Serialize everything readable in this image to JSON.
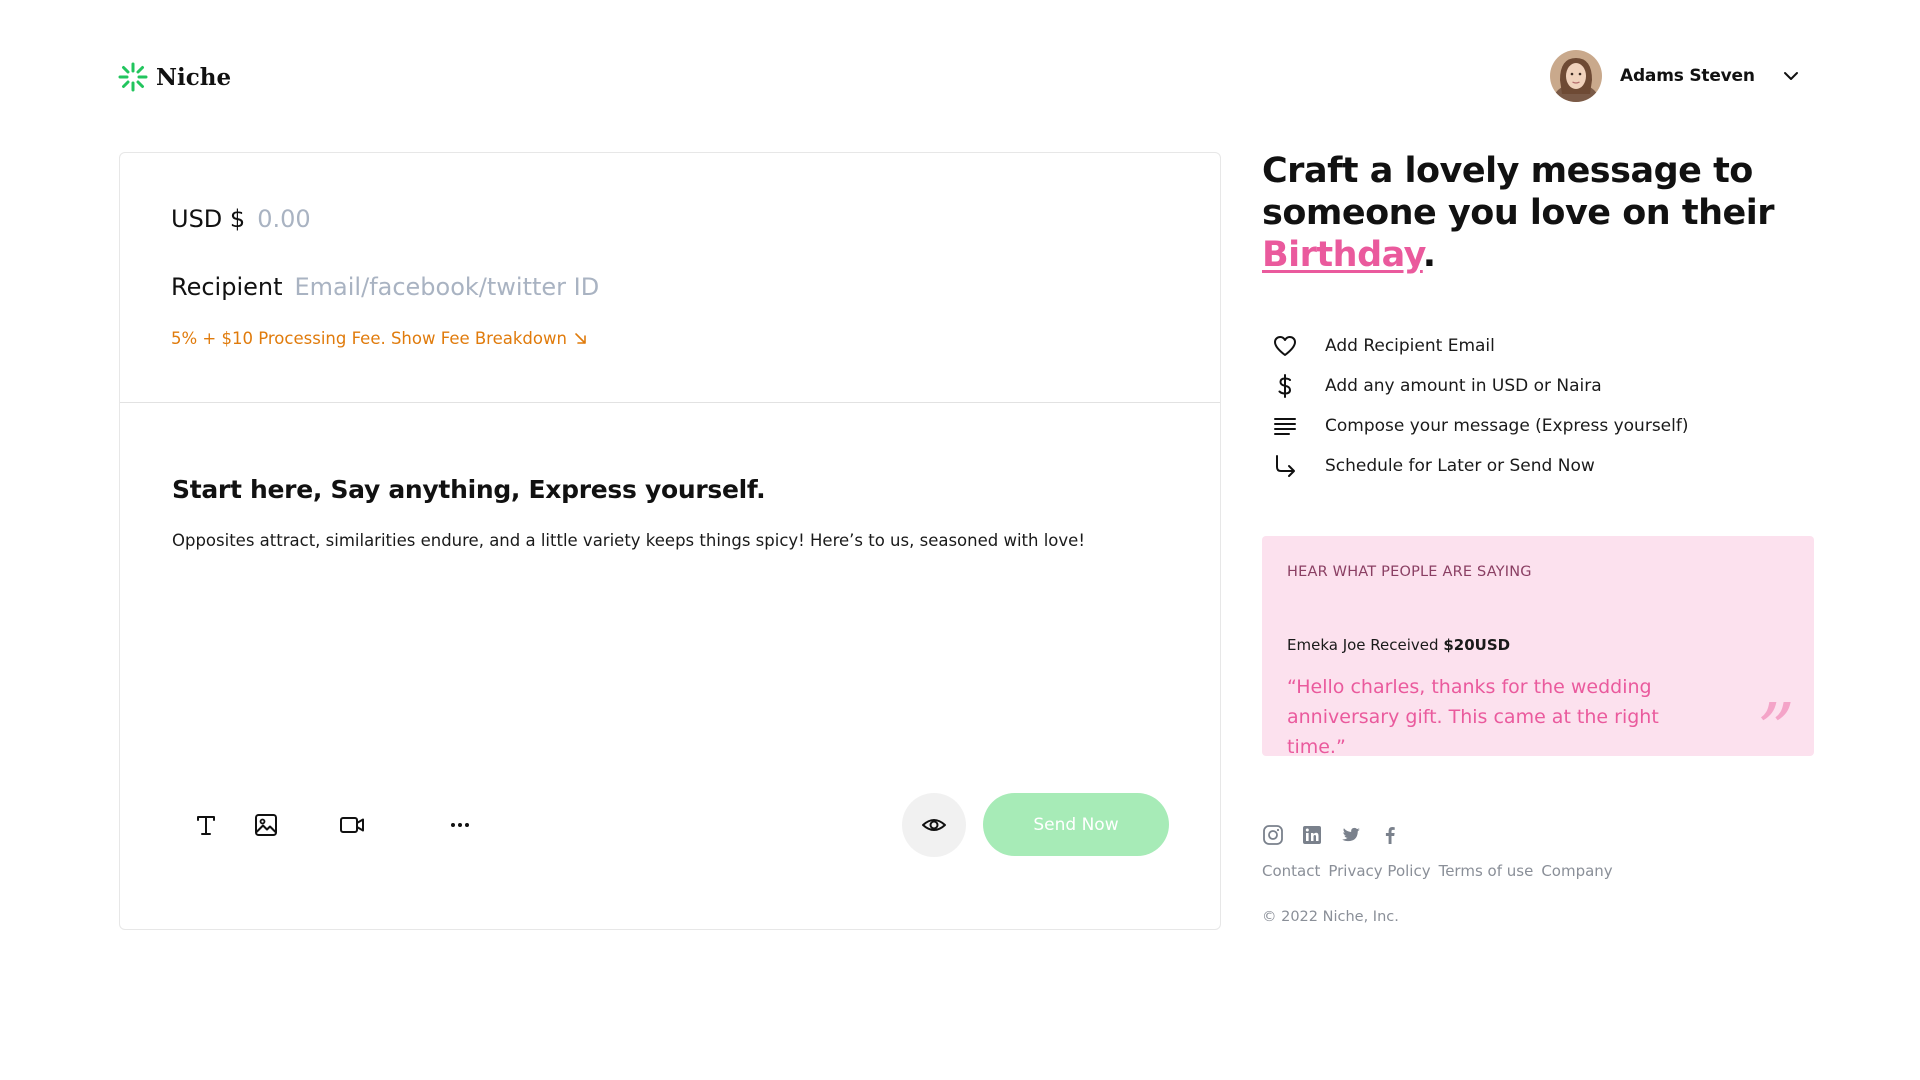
{
  "brand": {
    "name": "Niche",
    "accent": "#22c55e"
  },
  "user": {
    "name": "Adams Steven"
  },
  "form": {
    "currency_label": "USD $",
    "amount_placeholder": "0.00",
    "recipient_label": "Recipient",
    "recipient_placeholder": "Email/facebook/twitter ID",
    "fee_text": "5% + $10 Processing Fee. Show Fee Breakdown"
  },
  "message": {
    "title": "Start here, Say anything, Express yourself.",
    "body": "Opposites attract, similarities endure, and a little variety keeps things spicy! Here’s to us, seasoned with love!"
  },
  "toolbar": {
    "tools": [
      "text-icon",
      "image-icon",
      "video-icon",
      "more-icon"
    ],
    "preview_icon": "eye-icon",
    "send_label": "Send Now"
  },
  "headline": {
    "line1": "Craft a lovely message to",
    "line2": "someone you love on their",
    "accent_word": "Birthday",
    "end": "."
  },
  "steps": [
    {
      "icon": "heart-icon",
      "label": "Add Recipient Email"
    },
    {
      "icon": "dollar-icon",
      "label": "Add any amount in USD or Naira"
    },
    {
      "icon": "align-icon",
      "label": "Compose your message (Express yourself)"
    },
    {
      "icon": "arrow-turn-icon",
      "label": "Schedule for Later or Send Now"
    }
  ],
  "testimonial": {
    "heading": "HEAR WHAT PEOPLE ARE SAYING",
    "received_prefix": "Emeka Joe Received",
    "received_amount": "$20USD",
    "quote": "“Hello charles, thanks for the wedding anniversary gift. This came at the right time.”",
    "mark": "”"
  },
  "footer": {
    "social_icons": [
      "instagram-icon",
      "linkedin-icon",
      "twitter-icon",
      "facebook-icon"
    ],
    "links": [
      "Contact",
      "Privacy Policy",
      "Terms of use",
      "Company"
    ],
    "copyright": "© 2022 Niche, Inc."
  }
}
